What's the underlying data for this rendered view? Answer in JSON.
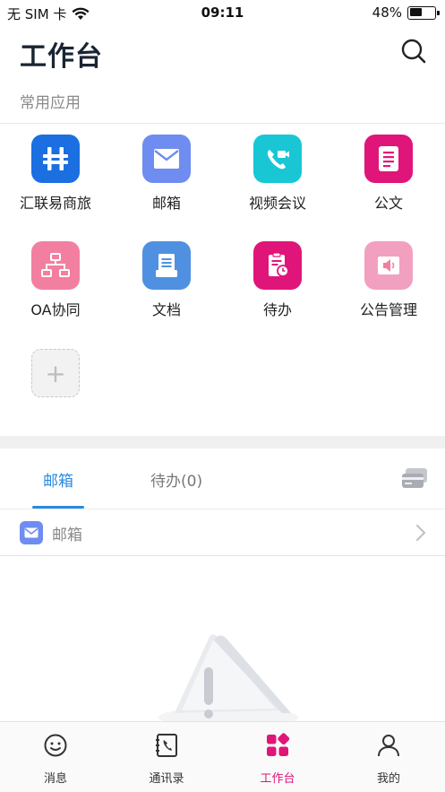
{
  "status_bar": {
    "carrier": "无 SIM 卡",
    "time": "09:11",
    "battery": "48%"
  },
  "header": {
    "title": "工作台"
  },
  "common_apps": {
    "section_label": "常用应用",
    "apps": [
      {
        "label": "汇联易商旅",
        "color": "#1b6fe0",
        "icon": "huilianyi-logo-icon"
      },
      {
        "label": "邮箱",
        "color": "#6f8cf0",
        "icon": "mail-icon"
      },
      {
        "label": "视频会议",
        "color": "#19c7d4",
        "icon": "video-call-icon"
      },
      {
        "label": "公文",
        "color": "#e0157a",
        "icon": "document-list-icon"
      },
      {
        "label": "OA协同",
        "color": "#f27fa0",
        "icon": "org-chart-icon"
      },
      {
        "label": "文档",
        "color": "#4f91e0",
        "icon": "file-stack-icon"
      },
      {
        "label": "待办",
        "color": "#e0157a",
        "icon": "todo-clock-icon"
      },
      {
        "label": "公告管理",
        "color": "#f2a0c0",
        "icon": "announcement-icon"
      }
    ],
    "add_label": "+"
  },
  "tabs": {
    "items": [
      {
        "label": "邮箱",
        "active": true
      },
      {
        "label": "待办(0)",
        "active": false
      }
    ]
  },
  "mail_row": {
    "label": "邮箱"
  },
  "tabbar": {
    "items": [
      {
        "label": "消息",
        "icon": "smiley-chat-icon",
        "active": false
      },
      {
        "label": "通讯录",
        "icon": "contacts-phone-icon",
        "active": false
      },
      {
        "label": "工作台",
        "icon": "workbench-grid-icon",
        "active": true
      },
      {
        "label": "我的",
        "icon": "person-icon",
        "active": false
      }
    ]
  },
  "colors": {
    "accent_blue": "#2a8ae0",
    "accent_magenta": "#e0157a"
  }
}
